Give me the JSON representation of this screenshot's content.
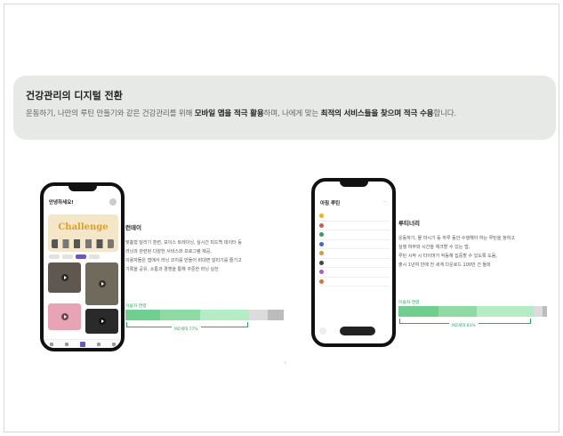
{
  "banner": {
    "title": "건강관리의 디지털 전환",
    "desc_pre": "운동하기, 나만의 루틴 만들기와 같은 건강관리를 위해 ",
    "desc_bold1": "모바일 앱을 적극 활용",
    "desc_mid": "하며, 나에게 맞는 ",
    "desc_bold2": "최적의 서비스들을 찾으며 적극 수용",
    "desc_post": "합니다."
  },
  "phone1": {
    "greeting": "안녕하세요!",
    "banner_title": "Challenge"
  },
  "feature1": {
    "title": "런데이",
    "desc": [
      "맞춤형 달리기 훈련, 보이스 트레이닝, 실시간 피드백 데이터 등",
      "러닝과 관련된 다양한 서비스와 프로그램 제공,",
      "이용자들은 앱에서 러닝 코치를 만들어 비대면 달리기를 즐기고",
      "기록을 공유, 소통과 경쟁을 통해 꾸준한 러닝 실천"
    ],
    "bar_label": "이용자 연령",
    "bar_label_right": "",
    "segments": [
      "",
      "",
      "",
      "",
      ""
    ],
    "bracket_label": "MZ세대 77%"
  },
  "phone2": {
    "title": "아침 루틴",
    "more": "···",
    "button": ""
  },
  "feature2": {
    "title": "루티너리",
    "desc": [
      "운동하기, 물 마시기 등 하루 동안 수행해야 하는 루틴을 정하고",
      "실행 여부와 시간을 체크할 수 있는 앱,",
      "루틴 시작 시 타이머가 작동해 집중할 수 있도록 도움,",
      "출시 1년여 만에 전 세계 다운로드 100만 건 돌파"
    ],
    "bar_label": "이용자 연령",
    "bar_label_right": "",
    "segments": [
      "",
      "",
      "",
      "",
      ""
    ],
    "bracket_label": "MZ세대 83%"
  },
  "page_mark": "?",
  "bar1_fractions": [
    0.22,
    0.47,
    0.78,
    0.9,
    1.0
  ],
  "bar2_fractions": [
    0.27,
    0.53,
    0.91,
    0.97,
    1.0
  ]
}
